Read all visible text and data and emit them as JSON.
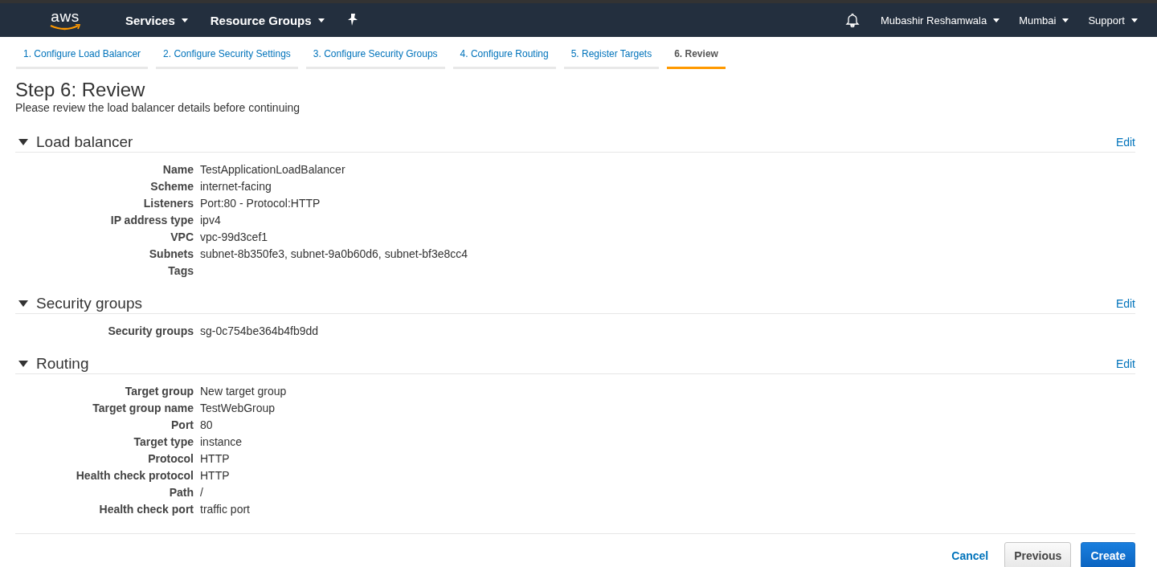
{
  "nav": {
    "logo": "aws",
    "menus": [
      {
        "label": "Services"
      },
      {
        "label": "Resource Groups"
      }
    ],
    "account_menus": [
      {
        "label": "Mubashir Reshamwala"
      },
      {
        "label": "Mumbai"
      },
      {
        "label": "Support"
      }
    ]
  },
  "steps": [
    {
      "label": "1. Configure Load Balancer",
      "selected": false
    },
    {
      "label": "2. Configure Security Settings",
      "selected": false
    },
    {
      "label": "3. Configure Security Groups",
      "selected": false
    },
    {
      "label": "4. Configure Routing",
      "selected": false
    },
    {
      "label": "5. Register Targets",
      "selected": false
    },
    {
      "label": "6. Review",
      "selected": true
    }
  ],
  "title": "Step 6: Review",
  "subtitle": "Please review the load balancer details before continuing",
  "sections": [
    {
      "title": "Load balancer",
      "expanded": true,
      "edit": "Edit",
      "rows": [
        {
          "label": "Name",
          "value": "TestApplicationLoadBalancer"
        },
        {
          "label": "Scheme",
          "value": "internet-facing"
        },
        {
          "label": "Listeners",
          "value": "Port:80 - Protocol:HTTP"
        },
        {
          "label": "IP address type",
          "value": "ipv4"
        },
        {
          "label": "VPC",
          "value": "vpc-99d3cef1"
        },
        {
          "label": "Subnets",
          "value": "subnet-8b350fe3, subnet-9a0b60d6, subnet-bf3e8cc4"
        },
        {
          "label": "Tags"
        }
      ]
    },
    {
      "title": "Security groups",
      "expanded": true,
      "edit": "Edit",
      "rows": [
        {
          "label": "Security groups",
          "value": "sg-0c754be364b4fb9dd"
        }
      ]
    },
    {
      "title": "Routing",
      "expanded": true,
      "edit": "Edit",
      "rows": [
        {
          "label": "Target group",
          "value": "New target group"
        },
        {
          "label": "Target group name",
          "value": "TestWebGroup"
        },
        {
          "label": "Port",
          "value": "80"
        },
        {
          "label": "Target type",
          "value": "instance"
        },
        {
          "label": "Protocol",
          "value": "HTTP"
        },
        {
          "label": "Health check protocol",
          "value": "HTTP"
        },
        {
          "label": "Path",
          "value": "/"
        },
        {
          "label": "Health check port",
          "value": "traffic port"
        }
      ]
    }
  ],
  "footer": {
    "cancel": "Cancel",
    "previous": "Previous",
    "create": "Create"
  }
}
